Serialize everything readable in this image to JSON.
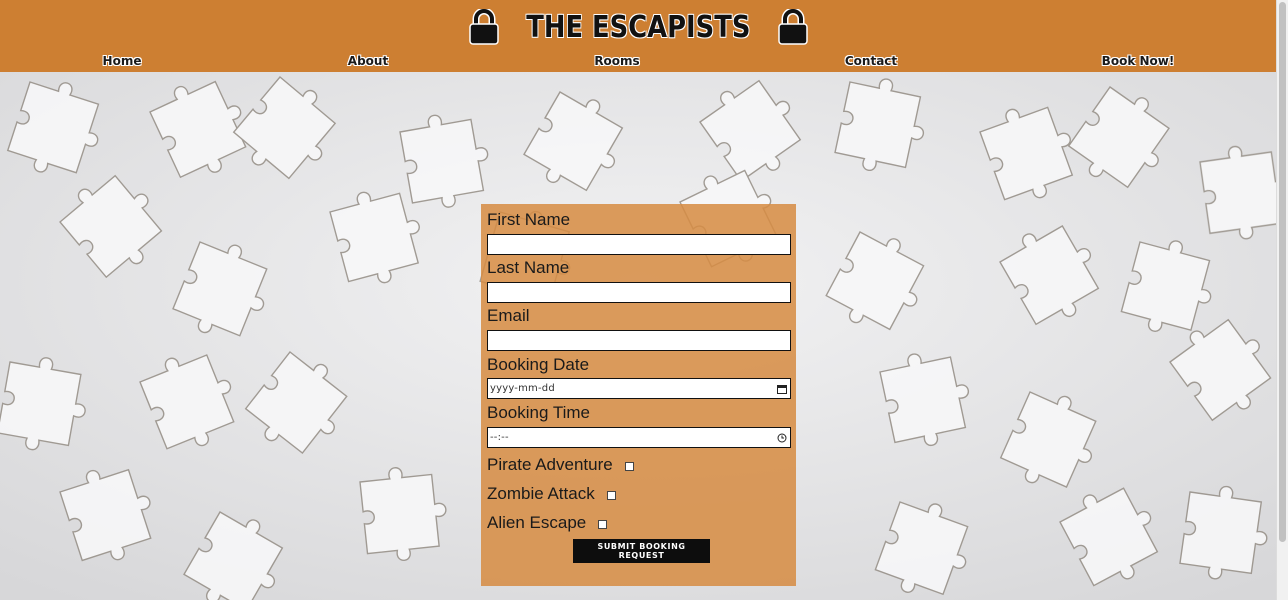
{
  "brand": {
    "title": "THE ESCAPISTS",
    "icon_left": "lock-icon",
    "icon_right": "lock-icon"
  },
  "nav": [
    {
      "label": "Home"
    },
    {
      "label": "About"
    },
    {
      "label": "Rooms"
    },
    {
      "label": "Contact"
    },
    {
      "label": "Book Now!"
    }
  ],
  "form": {
    "first_name_label": "First Name",
    "first_name_value": "",
    "last_name_label": "Last Name",
    "last_name_value": "",
    "email_label": "Email",
    "email_value": "",
    "date_label": "Booking Date",
    "date_placeholder": "yyyy-mm-dd",
    "time_label": "Booking Time",
    "time_placeholder": "--:--",
    "rooms": [
      {
        "label": "Pirate Adventure",
        "checked": false
      },
      {
        "label": "Zombie Attack",
        "checked": false
      },
      {
        "label": "Alien Escape",
        "checked": false
      }
    ],
    "submit_label": "SUBMIT BOOKING REQUEST"
  },
  "colors": {
    "header_bg": "#cd7f32",
    "form_bg": "#d68c42",
    "button_bg": "#0d0d0d",
    "page_bg": "#e6e6e7"
  }
}
